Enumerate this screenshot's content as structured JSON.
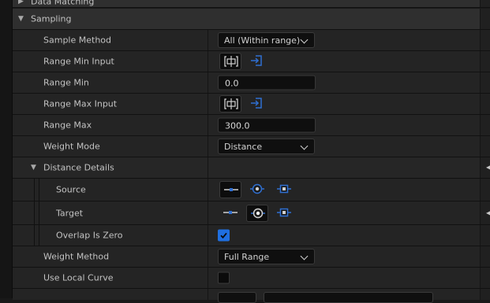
{
  "sections": {
    "data_matching": {
      "label": "Data Matching"
    },
    "sampling": {
      "label": "Sampling"
    }
  },
  "properties": {
    "sample_method": {
      "label": "Sample Method",
      "value": "All (Within range)"
    },
    "range_min_input": {
      "label": "Range Min Input"
    },
    "range_min": {
      "label": "Range Min",
      "value": "0.0"
    },
    "range_max_input": {
      "label": "Range Max Input"
    },
    "range_max": {
      "label": "Range Max",
      "value": "300.0"
    },
    "weight_mode": {
      "label": "Weight Mode",
      "value": "Distance"
    },
    "distance_details": {
      "label": "Distance Details"
    },
    "source": {
      "label": "Source",
      "selected": "line-icon"
    },
    "target": {
      "label": "Target",
      "selected": "circle-point-icon"
    },
    "overlap_is_zero": {
      "label": "Overlap Is Zero",
      "checked": true
    },
    "weight_method": {
      "label": "Weight Method",
      "value": "Full Range"
    },
    "use_local_curve": {
      "label": "Use Local Curve",
      "checked": false
    }
  },
  "colors": {
    "accent": "#2f6fd1",
    "check": "#1f6fe0"
  }
}
